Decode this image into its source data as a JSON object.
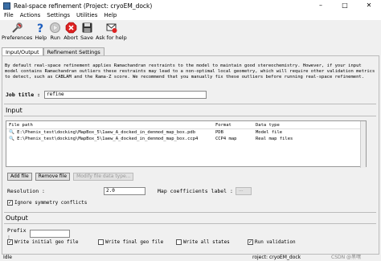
{
  "window": {
    "title": "Real-space refinement (Project: cryoEM_dock)"
  },
  "menu": [
    "File",
    "Actions",
    "Settings",
    "Utilities",
    "Help"
  ],
  "toolbar": [
    {
      "label": "Preferences",
      "icon": "preferences-icon"
    },
    {
      "label": "Help",
      "icon": "help-icon"
    },
    {
      "label": "Run",
      "icon": "run-icon"
    },
    {
      "label": "Abort",
      "icon": "abort-icon"
    },
    {
      "label": "Save",
      "icon": "save-icon"
    },
    {
      "label": "Ask for help",
      "icon": "ask-for-help-icon"
    }
  ],
  "tabs": [
    "Input/Output",
    "Refinement Settings"
  ],
  "description": "By default real-space refinement applies Ramachandran restraints to the model to maintain good stereochemistry. However, if your input model contains Ramachandran outliers these restraints may lead to a non-optimal local geometry, which will require other validation metrics to detect, such as CABLAM and the Rama-Z score. We recommend that you manually fix these outliers before running real-space refinement.",
  "job_title": {
    "label": "Job title :",
    "value": "refine"
  },
  "input": {
    "heading": "Input",
    "columns": [
      "File path",
      "Format",
      "Data type"
    ],
    "rows": [
      {
        "path": "E:\\Phenix_test\\docking\\MapBox_5\\1aew_A_docked_in_denmod_map_box.pdb",
        "format": "PDB",
        "type": "Model file"
      },
      {
        "path": "E:\\Phenix_test\\docking\\MapBox_5\\1aew_A_docked_in_denmod_map_box.ccp4",
        "format": "CCP4 map",
        "type": "Real map files"
      }
    ],
    "add_file": "Add file",
    "remove_file": "Remove file",
    "modify_type": "Modify file data type..."
  },
  "resolution": {
    "label": "Resolution :",
    "value": "2.0"
  },
  "map_coeff": {
    "label": "Map coefficients label :",
    "value": "---"
  },
  "ignore_symmetry": {
    "label": "Ignore symmetry conflicts",
    "checked": true
  },
  "output": {
    "heading": "Output",
    "prefix_label": "Prefix :",
    "prefix_value": "",
    "options": [
      {
        "label": "Write initial geo file",
        "checked": true
      },
      {
        "label": "Write final geo file",
        "checked": false
      },
      {
        "label": "Write all states",
        "checked": false
      },
      {
        "label": "Run validation",
        "checked": true
      }
    ]
  },
  "status": {
    "left": "Idle",
    "right": "roject: cryoEM_dock"
  },
  "watermark": "CSDN @黑嘿"
}
